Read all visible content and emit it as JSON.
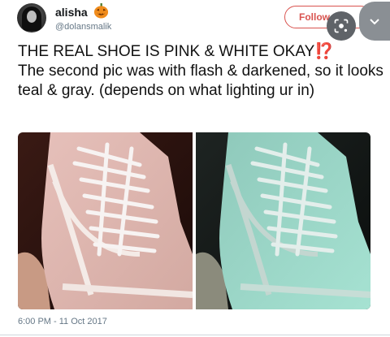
{
  "header": {
    "display_name": "alisha",
    "handle": "@dolansmalik",
    "emoji_icon": "jack-o-lantern-icon",
    "follow_label": "Follow"
  },
  "tweet": {
    "line1": "THE REAL SHOE IS PINK & WHITE OKAY",
    "line1_mark": "⁉️",
    "line2": "The second pic was with flash & darkened, so it looks teal & gray. (depends on what lighting ur in)"
  },
  "photos": {
    "left_tone": "#e8c6c0",
    "right_tone": "#a8e0d2"
  },
  "footer": {
    "timestamp": "6:00 PM - 11 Oct 2017"
  },
  "colors": {
    "accent": "#d9534f",
    "interrobang": "#e0245e"
  }
}
